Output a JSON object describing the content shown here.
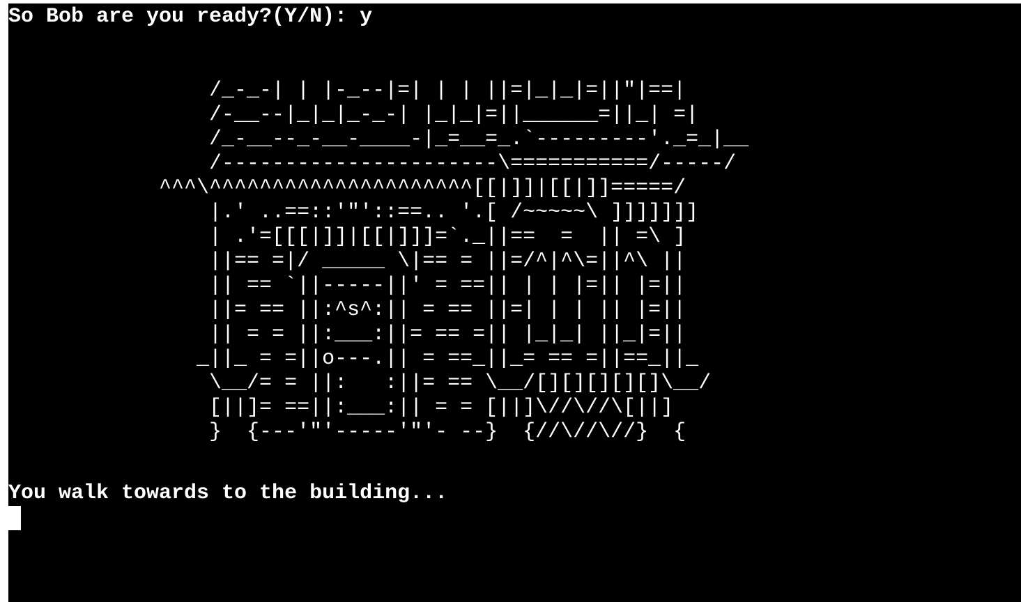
{
  "terminal": {
    "prompt_line": "So Bob are you ready?(Y/N): y",
    "ascii_art": [
      "                /_-_-| | |-_--|=| | | ||=|_|_|=||\"|==|",
      "                /-__--|_|_|_-_-| |_|_|=||______=||_| =|",
      "                /_-__--_-__-____-|_=__=_.`---------'._=_|__",
      "                /----------------------\\===========/-----/",
      "            ^^^\\^^^^^^^^^^^^^^^^^^^^^[[|]]|[[|]]=====/",
      "                |.' ..==::'\"'::==.. '.[ /~~~~~\\ ]]]]]]]",
      "                | .'=[[[|]]|[[|]]]=`._||==  =  || =\\ ]",
      "                ||== =|/ _____ \\|== = ||=/^|^\\=||^\\ ||",
      "                || == `||-----||' = ==|| | | |=|| |=||",
      "                ||= == ||:^s^:|| = == ||=| | | || |=||",
      "                || = = ||:___:||= == =|| |_|_| ||_|=||",
      "               _||_ = =||o---.|| = ==_||_= == =||==_||_",
      "                \\__/= = ||:   :||= == \\__/[][][][][]\\__/",
      "                [||]= ==||:___:|| = = [||]\\//\\//\\[||]",
      "                }  {---'\"'-----'\"'- --}  {//\\//\\//}  {"
    ],
    "output_line": "You walk towards to the building..."
  }
}
